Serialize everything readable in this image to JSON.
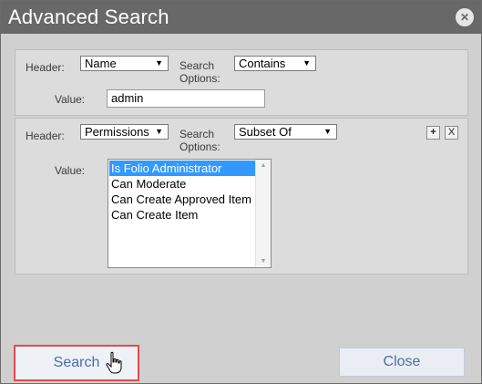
{
  "dialog": {
    "title": "Advanced Search",
    "close_icon": "close-icon"
  },
  "criteria": [
    {
      "header_label": "Header:",
      "header_value": "Name",
      "options_label_line1": "Search",
      "options_label_line2": "Options:",
      "options_value": "Contains",
      "value_label": "Value:",
      "value_text": "admin"
    },
    {
      "header_label": "Header:",
      "header_value": "Permissions",
      "options_label_line1": "Search",
      "options_label_line2": "Options:",
      "options_value": "Subset Of",
      "value_label": "Value:",
      "value_options": [
        "Is Folio Administrator",
        "Can Moderate",
        "Can Create Approved Item",
        "Can Create Item"
      ],
      "selected_index": 0,
      "add_icon": "plus-icon",
      "remove_icon": "x-icon",
      "add_label": "+",
      "remove_label": "X"
    }
  ],
  "buttons": {
    "search": "Search",
    "close": "Close"
  },
  "colors": {
    "title_bar": "#686868",
    "dialog_bg": "#d0d0d0",
    "panel_bg": "#dcdcdc",
    "selection": "#3399ff",
    "button_text": "#4a6ea8",
    "highlight_border": "#e34b4b"
  }
}
